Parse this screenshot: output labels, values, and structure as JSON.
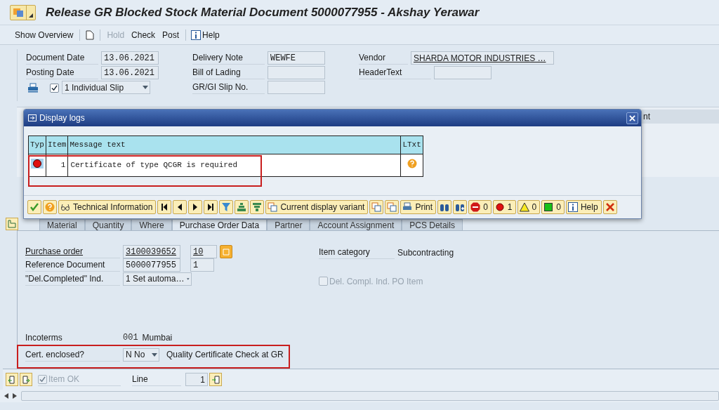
{
  "window": {
    "title": "Release GR Blocked Stock Material Document 5000077955 - Akshay Yerawar"
  },
  "toolbar": [
    {
      "kind": "text",
      "label": "Show Overview",
      "disabled": false
    },
    {
      "kind": "separator"
    },
    {
      "kind": "new",
      "disabled": false
    },
    {
      "kind": "separator"
    },
    {
      "kind": "text",
      "label": "Hold",
      "disabled": true
    },
    {
      "kind": "text",
      "label": "Check",
      "disabled": false
    },
    {
      "kind": "text",
      "label": "Post",
      "disabled": false
    },
    {
      "kind": "separator"
    },
    {
      "kind": "help",
      "label": "Help",
      "disabled": false
    }
  ],
  "header": {
    "columns": [
      [
        {
          "kind": "field",
          "label": "Document Date",
          "value": "13.06.2021"
        },
        {
          "kind": "field",
          "label": "Posting Date",
          "value": "13.06.2021"
        },
        {
          "kind": "print",
          "checked": true,
          "value": "1 Individual Slip"
        }
      ],
      [
        {
          "kind": "field",
          "label": "Delivery Note",
          "value": "WEWFE"
        },
        {
          "kind": "field",
          "label": "Bill of Lading"
        },
        {
          "kind": "field",
          "label": "GR/GI Slip No."
        }
      ],
      [
        {
          "kind": "field",
          "label": "Vendor",
          "value": "SHARDA MOTOR INDUSTRIES …",
          "link": true
        },
        {
          "kind": "field",
          "label": "HeaderText"
        }
      ]
    ]
  },
  "item_table": {
    "columns": [
      "nt"
    ]
  },
  "dialog": {
    "title": "Display logs",
    "columns": [
      "Typ",
      "Item",
      "Message text",
      "LTxt"
    ],
    "rows": [
      {
        "kind": "error",
        "item": "1",
        "message": "Certificate of type QCGR is required",
        "highlighted": true
      }
    ],
    "buttons": [
      {
        "kind": "ok"
      },
      {
        "kind": "question"
      },
      {
        "kind": "tech",
        "label": "Technical Information"
      },
      {
        "kind": "first"
      },
      {
        "kind": "prev"
      },
      {
        "kind": "next"
      },
      {
        "kind": "last"
      },
      {
        "kind": "filter"
      },
      {
        "kind": "sort-up"
      },
      {
        "kind": "sort-down"
      },
      {
        "kind": "variant",
        "label": "Current display variant"
      },
      {
        "kind": "copy"
      },
      {
        "kind": "copy"
      },
      {
        "kind": "print",
        "label": "Print"
      },
      {
        "kind": "find"
      },
      {
        "kind": "find-next"
      },
      {
        "kind": "stop",
        "label": "0"
      },
      {
        "kind": "error",
        "label": "1"
      },
      {
        "kind": "warning",
        "label": "0"
      },
      {
        "kind": "success",
        "label": "0"
      },
      {
        "kind": "info",
        "label": "Help"
      },
      {
        "kind": "cancel"
      }
    ]
  },
  "tabs": [
    {
      "label": "Material",
      "selected": false
    },
    {
      "label": "Quantity",
      "selected": false
    },
    {
      "label": "Where",
      "selected": false
    },
    {
      "label": "Purchase Order Data",
      "selected": true
    },
    {
      "label": "Partner",
      "selected": false
    },
    {
      "label": "Account Assignment",
      "selected": false
    },
    {
      "label": "PCS Details",
      "selected": false
    }
  ],
  "po_data": {
    "purchase_order": {
      "label": "Purchase order",
      "value": "3100039652",
      "item": "10"
    },
    "reference_document": {
      "label": "Reference Document",
      "value": "5000077955",
      "item": "1"
    },
    "del_completed": {
      "label": "\"Del.Completed\" Ind.",
      "value": "1 Set automa…"
    },
    "item_category": {
      "label": "Item category",
      "value": "Subcontracting"
    },
    "del_compl_po_item": {
      "label": "Del. Compl. Ind. PO Item",
      "checked": false,
      "disabled": true
    },
    "incoterms": {
      "label": "Incoterms",
      "code": "001",
      "place": "Mumbai"
    },
    "cert_enclosed": {
      "label": "Cert. enclosed?",
      "value": "N No",
      "description": "Quality Certificate Check at GR",
      "highlighted": true
    }
  },
  "footer": {
    "item_ok": {
      "label": "Item OK",
      "checked": true,
      "disabled": true
    },
    "line": {
      "label": "Line",
      "value": "1"
    }
  }
}
